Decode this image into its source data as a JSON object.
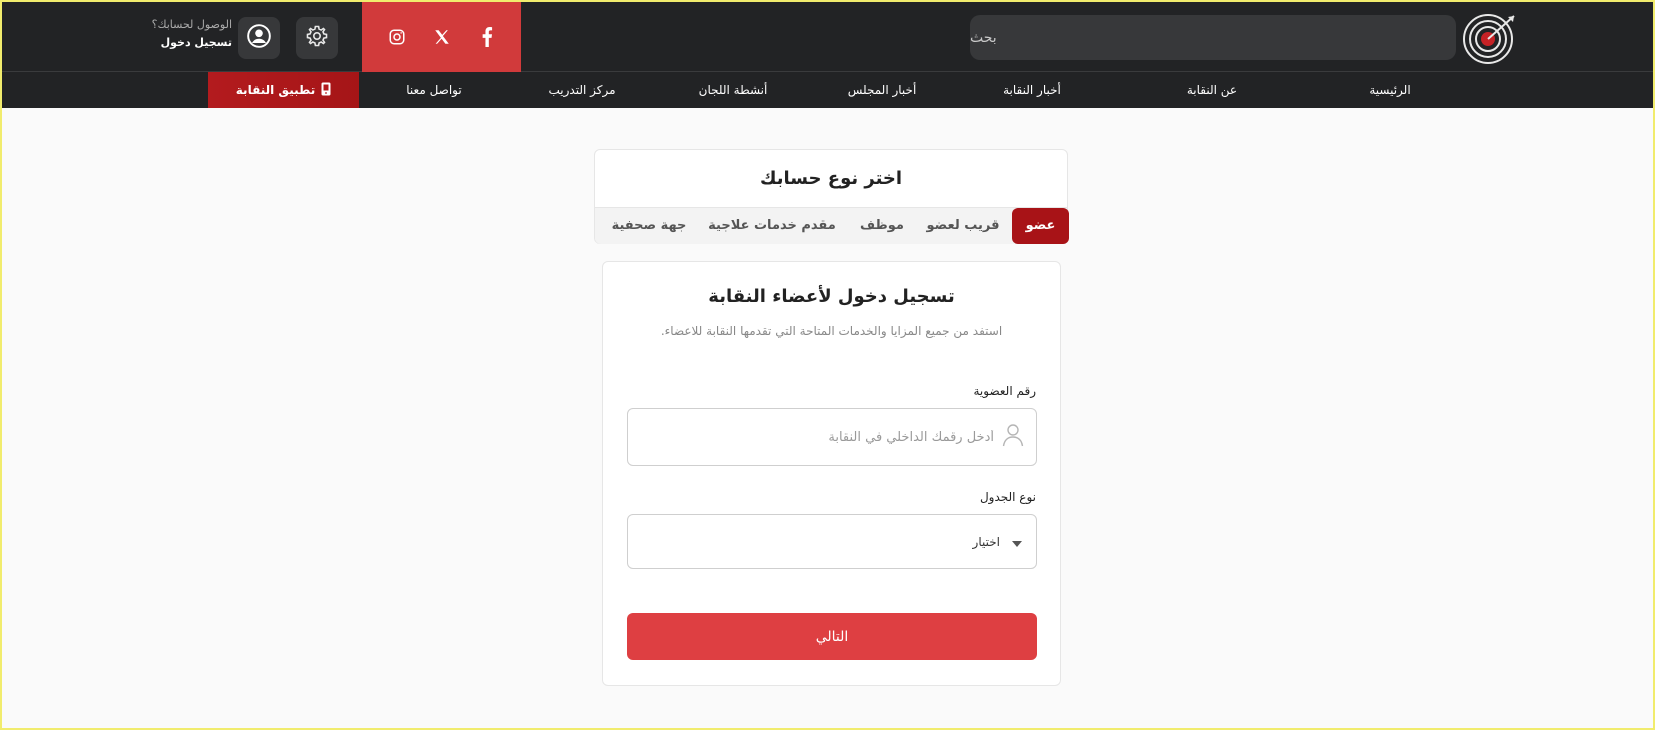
{
  "header": {
    "search_placeholder": "بحث",
    "account_question": "الوصول لحسابك؟",
    "login_link": "تسجيل دخول",
    "icons": {
      "logo": "target-logo-icon",
      "settings": "gear-icon",
      "user": "user-circle-icon",
      "social": [
        "facebook-icon",
        "x-twitter-icon",
        "instagram-icon"
      ]
    },
    "social_bg": "#d13a3b"
  },
  "nav": {
    "items": [
      "الرئيسية",
      "عن النقابة",
      "أخبار النقابة",
      "أخبار المجلس",
      "أنشطة اللجان",
      "مركز التدريب",
      "تواصل معنا"
    ],
    "app_label": "تطبيق النقابة",
    "app_icon": "mobile-phone-icon",
    "accent": "#a81317"
  },
  "account_type": {
    "title": "اختر نوع حسابك",
    "tabs": [
      "عضو",
      "قريب لعضو",
      "موظف",
      "مقدم خدمات علاجية",
      "جهة صحفية"
    ],
    "active_index": 0
  },
  "login_form": {
    "title": "تسجيل دخول لأعضاء النقابة",
    "subtitle": "استفد من جميع المزايا والخدمات المتاحة التي تقدمها النقابة للاعضاء.",
    "membership_label": "رقم العضوية",
    "membership_placeholder": "أدخل رقمك الداخلي في النقابة",
    "membership_value": "",
    "table_type_label": "نوع الجدول",
    "table_type_selected": "اختيار",
    "next_button": "التالي",
    "button_color": "#de3f42"
  }
}
